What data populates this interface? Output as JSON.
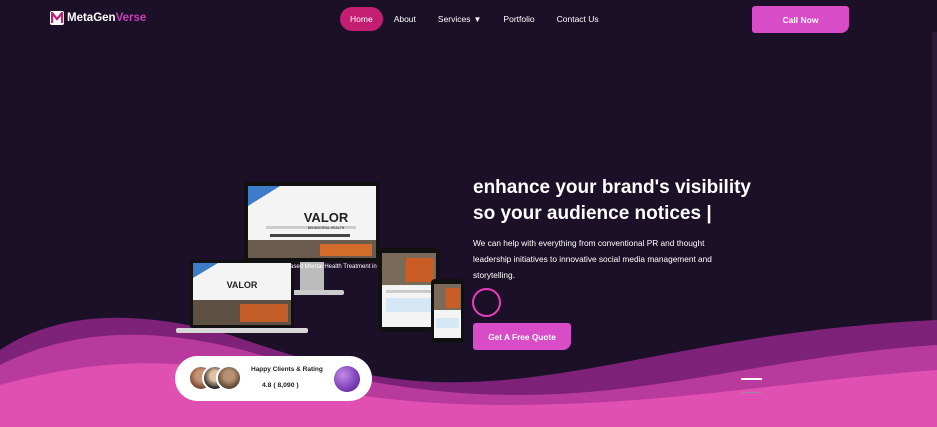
{
  "brand": {
    "name_part1": "MetaGen",
    "name_part2": "Verse",
    "logo_icon": "m-logo-icon"
  },
  "nav": {
    "items": [
      {
        "label": "Home",
        "active": true
      },
      {
        "label": "About",
        "active": false
      },
      {
        "label": "Services",
        "active": false,
        "caret": "▼"
      },
      {
        "label": "Portfolio",
        "active": false
      },
      {
        "label": "Contact Us",
        "active": false
      }
    ]
  },
  "header": {
    "call_label": "Call Now"
  },
  "hero": {
    "headline_line1": "enhance your brand's visibility",
    "headline_line2": "so your audience notices |",
    "subtext": "We can help with everything from conventional PR and thought leadership initiatives to innovative social media management and storytelling.",
    "cta_label": "Get A Free Quote"
  },
  "mockup": {
    "brand": "VALOR",
    "tagline": "BEHAVIORAL HEALTH",
    "banner_text": "ased Mental Health Treatment in"
  },
  "rating": {
    "title": "Happy Clients & Rating",
    "value": "4.8 ( 8,090 )"
  },
  "colors": {
    "background": "#1b1027",
    "accent": "#d94cc8",
    "active_nav": "#c41e72",
    "wave_light": "#e04fb2",
    "wave_dark": "#9c2a8c"
  }
}
